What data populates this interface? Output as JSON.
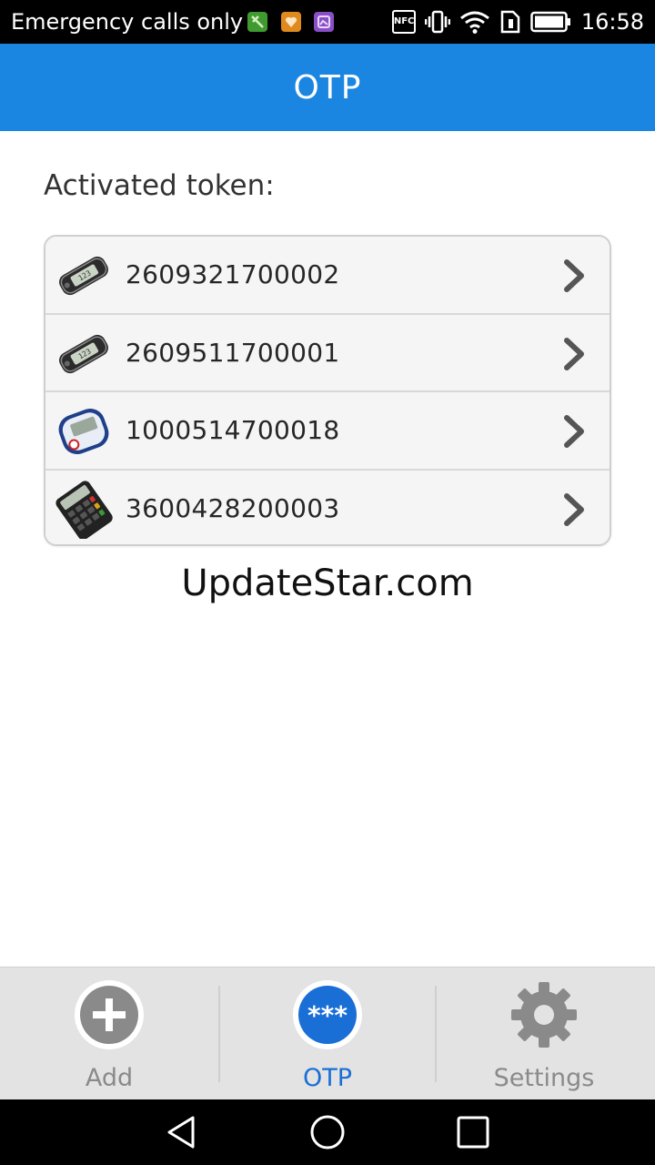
{
  "status_bar": {
    "carrier": "Emergency calls only",
    "nfc": "NFC",
    "time": "16:58",
    "icons": [
      "app-notification-green-icon",
      "app-notification-orange-icon",
      "app-notification-purple-icon",
      "nfc-icon",
      "vibrate-icon",
      "wifi-icon",
      "sim-icon",
      "battery-icon"
    ]
  },
  "app_bar": {
    "title": "OTP"
  },
  "content": {
    "section_label": "Activated token:",
    "tokens": [
      {
        "id": "2609321700002",
        "icon": "keyfob-token-icon"
      },
      {
        "id": "2609511700001",
        "icon": "keyfob-token-icon"
      },
      {
        "id": "1000514700018",
        "icon": "display-token-icon"
      },
      {
        "id": "3600428200003",
        "icon": "calculator-token-icon"
      }
    ],
    "watermark": "UpdateStar.com"
  },
  "tabs": [
    {
      "label": "Add",
      "icon": "plus-icon",
      "active": false
    },
    {
      "label": "OTP",
      "icon": "otp-asterisks-icon",
      "active": true,
      "icon_text": "***"
    },
    {
      "label": "Settings",
      "icon": "gear-icon",
      "active": false
    }
  ],
  "colors": {
    "primary": "#1a86e1",
    "active_tab": "#1a6fd6",
    "tab_bar": "#e3e3e3"
  },
  "nav_bar": {
    "buttons": [
      "back-icon",
      "home-icon",
      "recents-icon"
    ]
  }
}
